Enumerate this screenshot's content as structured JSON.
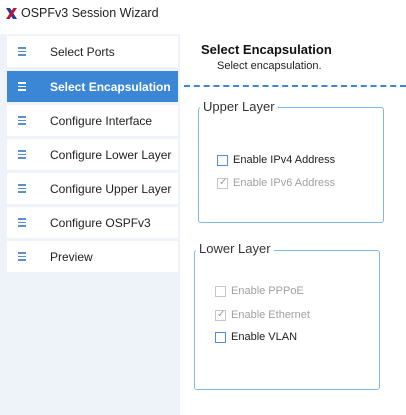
{
  "window": {
    "title": "OSPFv3 Session Wizard",
    "logo_icon": "x-logo-icon",
    "logo_color": "#1f3f99"
  },
  "sidebar": {
    "items": [
      {
        "label": "Select Ports",
        "active": false
      },
      {
        "label": "Select Encapsulation",
        "active": true
      },
      {
        "label": "Configure Interface",
        "active": false
      },
      {
        "label": "Configure Lower Layer",
        "active": false
      },
      {
        "label": "Configure Upper Layer",
        "active": false
      },
      {
        "label": "Configure OSPFv3",
        "active": false
      },
      {
        "label": "Preview",
        "active": false
      }
    ],
    "item_icon": "drag-handle-icon",
    "active_color": "#3c86d6"
  },
  "main": {
    "title": "Select Encapsulation",
    "subtitle": "Select encapsulation.",
    "upper_layer": {
      "legend": "Upper Layer",
      "options": [
        {
          "label": "Enable IPv4 Address",
          "checked": false,
          "enabled": true
        },
        {
          "label": "Enable IPv6 Address",
          "checked": true,
          "enabled": false
        }
      ]
    },
    "lower_layer": {
      "legend": "Lower Layer",
      "options": [
        {
          "label": "Enable PPPoE",
          "checked": false,
          "enabled": false
        },
        {
          "label": "Enable Ethernet",
          "checked": true,
          "enabled": false
        },
        {
          "label": "Enable VLAN",
          "checked": false,
          "enabled": true
        }
      ]
    }
  }
}
